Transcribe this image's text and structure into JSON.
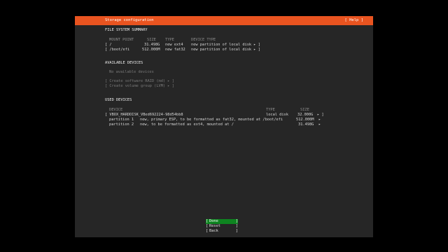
{
  "header": {
    "title": "Storage configuration",
    "help": "[ Help ]"
  },
  "fs_summary": {
    "heading": "FILE SYSTEM SUMMARY",
    "columns": [
      "MOUNT POINT",
      "SIZE",
      "TYPE",
      "DEVICE TYPE"
    ],
    "rows": [
      {
        "mount": "[ /",
        "size": "31.498G",
        "type": "new ext4",
        "device_type": "new partition of local disk ▸ ]"
      },
      {
        "mount": "[ /boot/efi",
        "size": "512.000M",
        "type": "new fat32",
        "device_type": "new partition of local disk ▸ ]"
      }
    ]
  },
  "available": {
    "heading": "AVAILABLE DEVICES",
    "empty": "No available devices",
    "create_raid": "[ Create software RAID (md) ▸ ]",
    "create_lvm": "[ Create volume group (LVM) ▸ ]"
  },
  "used": {
    "heading": "USED DEVICES",
    "columns": {
      "device": "DEVICE",
      "type": "TYPE",
      "size": "SIZE"
    },
    "disk": {
      "name": "[ VBOX_HARDDISK_VBed692224-98d54bb8",
      "type": "local disk",
      "size": "32.000G",
      "arrow": "▸ ]"
    },
    "partitions": [
      {
        "label": "partition 1",
        "desc": "new, primary ESP, to be formatted as fat32, mounted at /boot/efi",
        "size": "512.000M",
        "arrow": "▸"
      },
      {
        "label": "partition 2",
        "desc": "new, to be formatted as ext4, mounted at /",
        "size": "31.498G",
        "arrow": "▸"
      }
    ]
  },
  "buttons": {
    "open": "[",
    "close": "]",
    "done": "Done",
    "reset": "Reset",
    "back": "Back"
  },
  "colors": {
    "header_bg": "#e95420",
    "focus_bg": "#0e8420",
    "screen_bg": "#262626"
  }
}
